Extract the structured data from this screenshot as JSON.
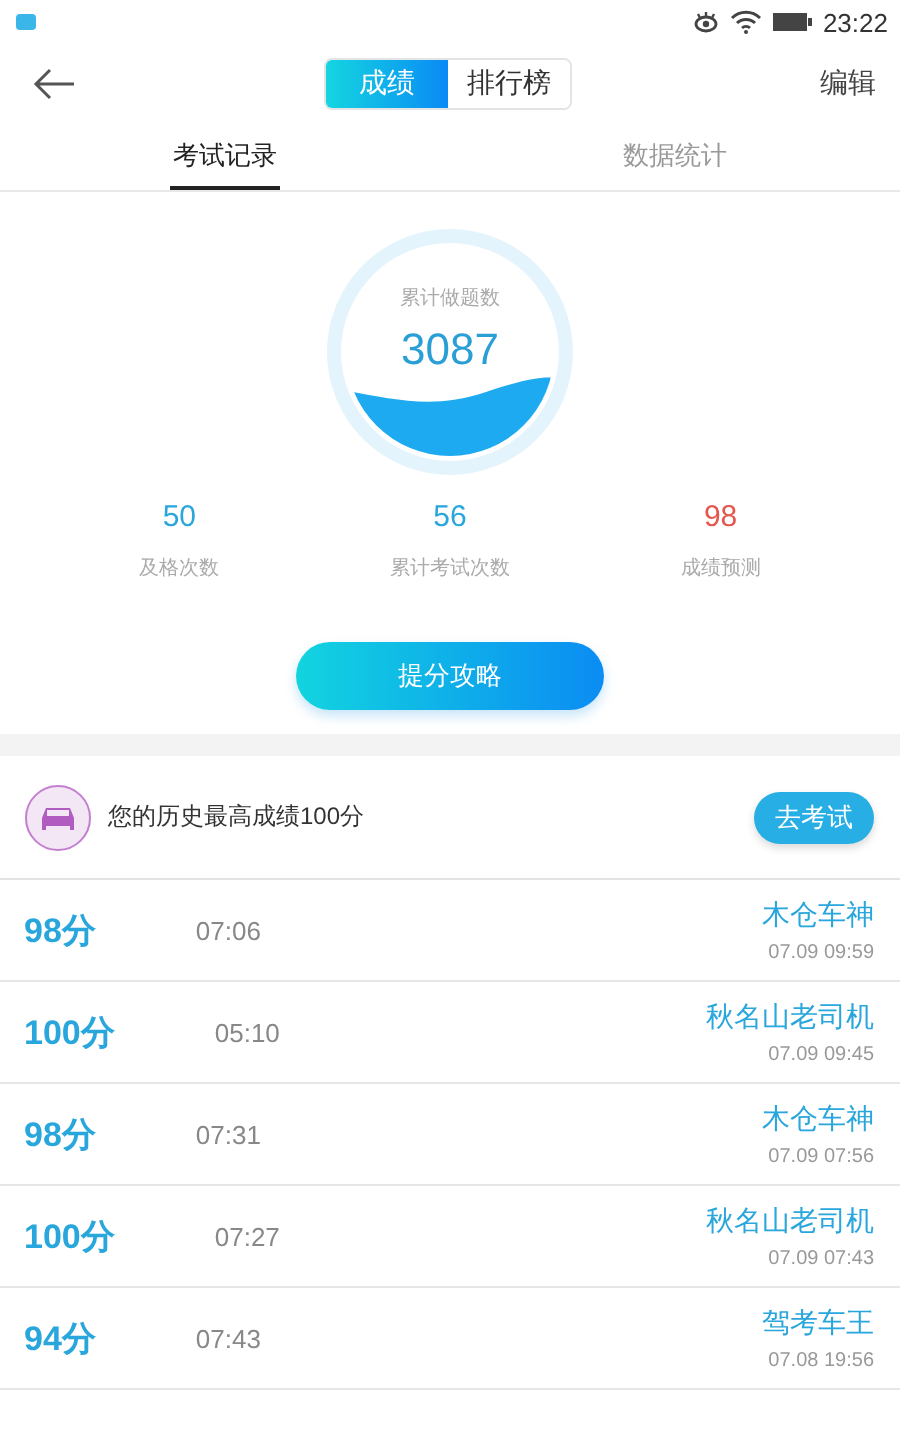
{
  "status_bar": {
    "time": "23:22"
  },
  "header": {
    "segments": [
      {
        "label": "成绩",
        "selected": true
      },
      {
        "label": "排行榜",
        "selected": false
      }
    ],
    "action": "编辑"
  },
  "tabs": [
    {
      "label": "考试记录",
      "selected": true
    },
    {
      "label": "数据统计",
      "selected": false
    }
  ],
  "gauge": {
    "label": "累计做题数",
    "value": "3087"
  },
  "stats": [
    {
      "value": "50",
      "label": "及格次数",
      "kind": "normal"
    },
    {
      "value": "56",
      "label": "累计考试次数",
      "kind": "normal"
    },
    {
      "value": "98",
      "label": "成绩预测",
      "kind": "prediction"
    }
  ],
  "tips_button": "提分攻略",
  "best": {
    "text": "您的历史最高成绩100分",
    "button": "去考试"
  },
  "records": [
    {
      "score": "98分",
      "duration": "07:06",
      "title": "木仓车神",
      "date": "07.09  09:59"
    },
    {
      "score": "100分",
      "duration": "05:10",
      "title": "秋名山老司机",
      "date": "07.09  09:45"
    },
    {
      "score": "98分",
      "duration": "07:31",
      "title": "木仓车神",
      "date": "07.09  07:56"
    },
    {
      "score": "100分",
      "duration": "07:27",
      "title": "秋名山老司机",
      "date": "07.09  07:43"
    },
    {
      "score": "94分",
      "duration": "07:43",
      "title": "驾考车王",
      "date": "07.08  19:56"
    }
  ]
}
